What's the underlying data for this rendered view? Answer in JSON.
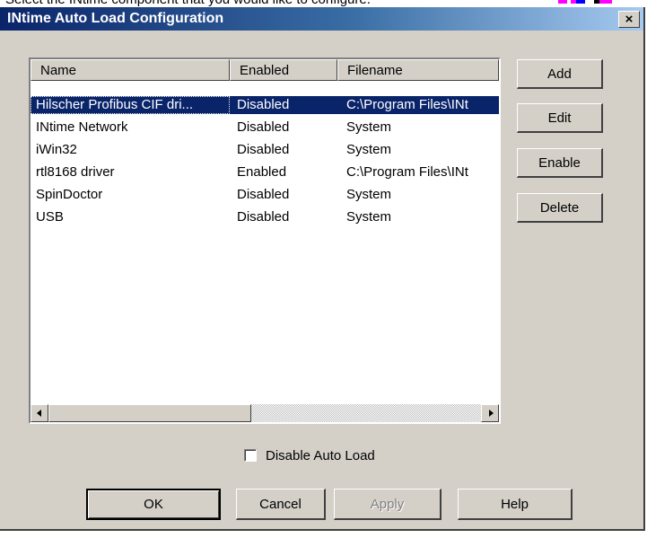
{
  "background": {
    "partial_text": "Select the INtime component that you would like to configure."
  },
  "dialog": {
    "title": "INtime Auto Load Configuration",
    "close_label": "×"
  },
  "list": {
    "columns": [
      "Name",
      "Enabled",
      "Filename"
    ],
    "rows": [
      {
        "name": "Hilscher Profibus CIF dri...",
        "enabled": "Disabled",
        "filename": "C:\\Program Files\\INt",
        "selected": true
      },
      {
        "name": "INtime Network",
        "enabled": "Disabled",
        "filename": "System",
        "selected": false
      },
      {
        "name": "iWin32",
        "enabled": "Disabled",
        "filename": "System",
        "selected": false
      },
      {
        "name": "rtl8168 driver",
        "enabled": "Enabled",
        "filename": "C:\\Program Files\\INt",
        "selected": false
      },
      {
        "name": "SpinDoctor",
        "enabled": "Disabled",
        "filename": "System",
        "selected": false
      },
      {
        "name": "USB",
        "enabled": "Disabled",
        "filename": "System",
        "selected": false
      }
    ]
  },
  "side_buttons": {
    "add": "Add",
    "edit": "Edit",
    "enable": "Enable",
    "delete": "Delete"
  },
  "checkbox": {
    "label": "Disable Auto Load",
    "checked": false
  },
  "footer_buttons": {
    "ok": "OK",
    "cancel": "Cancel",
    "apply": "Apply",
    "help": "Help"
  },
  "colors": {
    "selection": "#0a246a",
    "title_gradient_start": "#0a246a",
    "title_gradient_end": "#a6caf0",
    "face": "#d4d0c8"
  }
}
